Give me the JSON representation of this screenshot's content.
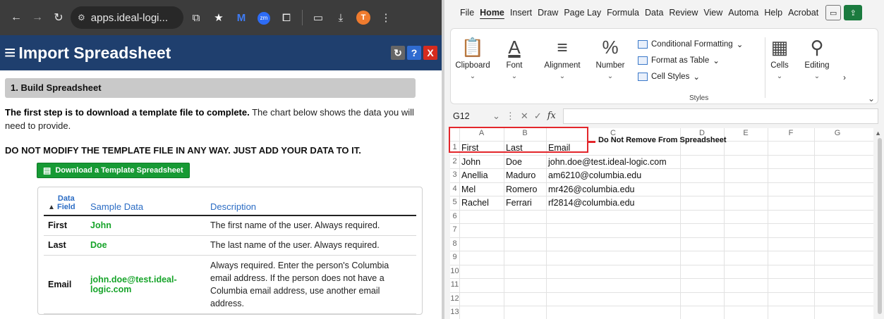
{
  "browser": {
    "url": "apps.ideal-logi..."
  },
  "app": {
    "title": "Import Spreadsheet",
    "buttons": {
      "refresh": "↻",
      "help": "?",
      "close": "X"
    }
  },
  "section": {
    "heading": "1. Build Spreadsheet",
    "intro_bold": "The first step is to download a template file to complete.",
    "intro_rest": " The chart below shows the data you will need to provide.",
    "warning_a": "DO NOT MODIFY THE TEMPLATE FILE IN ANY WAY",
    "warning_b": ". JUST ADD YOUR DATA TO IT.",
    "download_label": "Download a Template Spreadsheet"
  },
  "table": {
    "headers": {
      "field": "Data\nField",
      "sample": "Sample Data",
      "description": "Description"
    },
    "rows": [
      {
        "field": "First",
        "sample": "John",
        "description": "The first name of the user. Always required."
      },
      {
        "field": "Last",
        "sample": "Doe",
        "description": "The last name of the user. Always required."
      },
      {
        "field": "Email",
        "sample": "john.doe@test.ideal-logic.com",
        "description": "Always required. Enter the person's Columbia email address. If the person does not have a Columbia email address, use another email address."
      }
    ]
  },
  "excel": {
    "tabs": [
      "File",
      "Home",
      "Insert",
      "Draw",
      "Page Lay",
      "Formula",
      "Data",
      "Review",
      "View",
      "Automa",
      "Help",
      "Acrobat"
    ],
    "active_tab": "Home",
    "ribbon": {
      "clipboard": "Clipboard",
      "font": "Font",
      "alignment": "Alignment",
      "number": "Number",
      "conditional": "Conditional Formatting",
      "format_table": "Format as Table",
      "cell_styles": "Cell Styles",
      "styles": "Styles",
      "cells": "Cells",
      "editing": "Editing"
    },
    "namebox": "G12",
    "columns": [
      "A",
      "B",
      "C",
      "D",
      "E",
      "F",
      "G"
    ],
    "rows": [
      [
        "First",
        "Last",
        "Email"
      ],
      [
        "John",
        "Doe",
        "john.doe@test.ideal-logic.com"
      ],
      [
        "Anellia",
        "Maduro",
        "am6210@columbia.edu"
      ],
      [
        "Mel",
        "Romero",
        "mr426@columbia.edu"
      ],
      [
        "Rachel",
        "Ferrari",
        "rf2814@columbia.edu"
      ]
    ],
    "row_numbers": [
      "1",
      "2",
      "3",
      "4",
      "5",
      "6",
      "7",
      "8",
      "9",
      "10",
      "11",
      "12",
      "13"
    ],
    "annotation": "Do Not Remove From Spreadsheet"
  }
}
